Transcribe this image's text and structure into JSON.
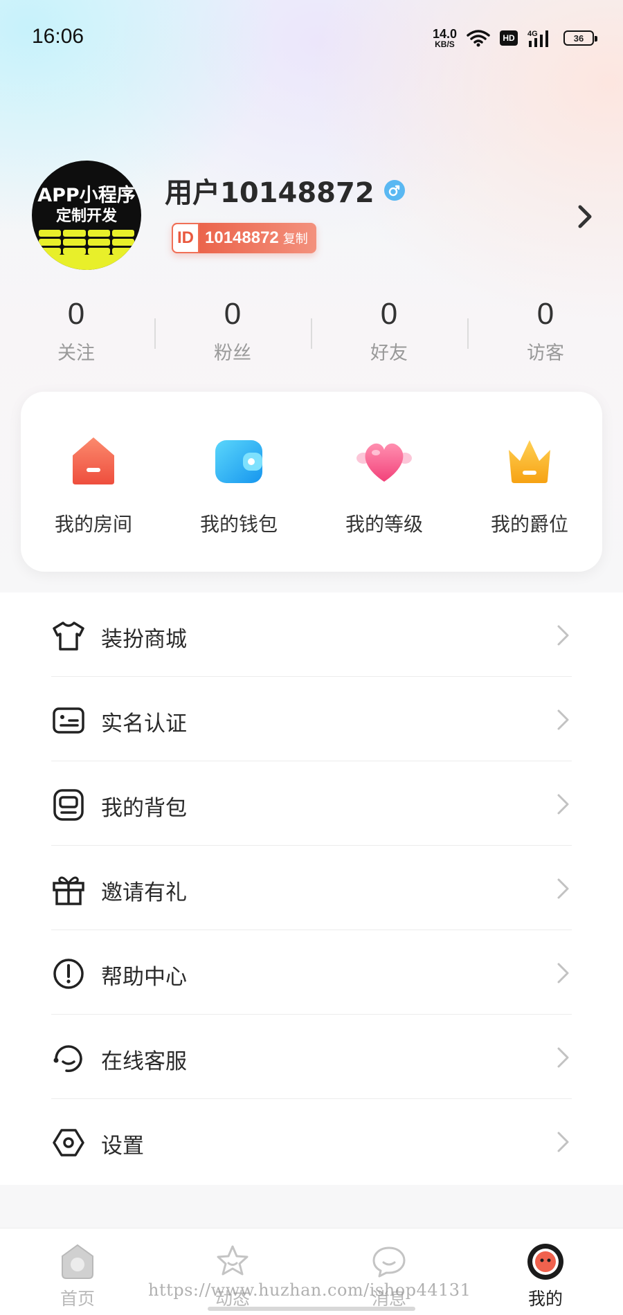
{
  "status_bar": {
    "time": "16:06",
    "net_speed_value": "14.0",
    "net_speed_unit": "KB/S",
    "hd_label": "HD",
    "network_label": "4G",
    "battery_level": "36"
  },
  "profile": {
    "avatar_text_line1": "APP小程序",
    "avatar_text_line2": "定制开发",
    "username": "用户10148872",
    "gender": "male",
    "id_label": "ID",
    "id_value": "10148872",
    "copy_label": "复制"
  },
  "stats": [
    {
      "value": "0",
      "label": "关注"
    },
    {
      "value": "0",
      "label": "粉丝"
    },
    {
      "value": "0",
      "label": "好友"
    },
    {
      "value": "0",
      "label": "访客"
    }
  ],
  "quick_actions": [
    {
      "label": "我的房间",
      "icon": "room-icon",
      "color": "#f0624e"
    },
    {
      "label": "我的钱包",
      "icon": "wallet-icon",
      "color": "#1fb2f0"
    },
    {
      "label": "我的等级",
      "icon": "heart-icon",
      "color": "#f55b8a"
    },
    {
      "label": "我的爵位",
      "icon": "crown-icon",
      "color": "#f7b52a"
    }
  ],
  "menu": [
    {
      "label": "装扮商城",
      "icon": "tshirt-icon"
    },
    {
      "label": "实名认证",
      "icon": "id-card-icon"
    },
    {
      "label": "我的背包",
      "icon": "backpack-icon"
    },
    {
      "label": "邀请有礼",
      "icon": "gift-icon"
    },
    {
      "label": "帮助中心",
      "icon": "help-icon"
    },
    {
      "label": "在线客服",
      "icon": "headset-icon"
    },
    {
      "label": "设置",
      "icon": "settings-icon"
    }
  ],
  "tab_bar": [
    {
      "label": "首页",
      "icon": "home-icon",
      "active": false
    },
    {
      "label": "动态",
      "icon": "moments-icon",
      "active": false
    },
    {
      "label": "消息",
      "icon": "message-icon",
      "active": false
    },
    {
      "label": "我的",
      "icon": "profile-icon",
      "active": true
    }
  ],
  "watermark": "https://www.huzhan.com/ishop44131",
  "colors": {
    "id_badge": "#e9593f",
    "accent_blue": "#5ab8f2",
    "tab_active": "#222222",
    "tab_inactive": "#b8b8b8"
  }
}
